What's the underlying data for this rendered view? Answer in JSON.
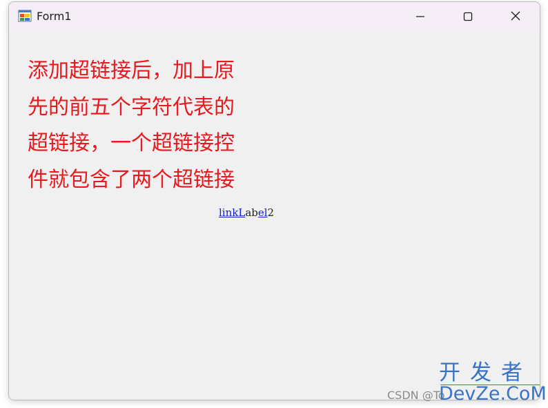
{
  "window": {
    "title": "Form1",
    "icon": "winforms-app-icon",
    "controls": {
      "minimize_icon": "minimize-icon",
      "maximize_icon": "maximize-icon",
      "close_icon": "close-icon"
    }
  },
  "content": {
    "description_label": "添加超链接后，加上原先的前五个字符代表的超链接，一个超链接控件就包含了两个超链接",
    "description_color": "#e8191f",
    "link_label": {
      "parts": [
        {
          "text": "linkL",
          "is_link": true
        },
        {
          "text": "ab",
          "is_link": false
        },
        {
          "text": "el",
          "is_link": true
        },
        {
          "text": "2",
          "is_link": false
        }
      ],
      "link_color": "#0b1fd6"
    }
  },
  "watermarks": {
    "csdn": "CSDN @To",
    "devze_top": "开发者",
    "devze_bottom": "DevZe.CoM",
    "color": "#3a73c5"
  }
}
